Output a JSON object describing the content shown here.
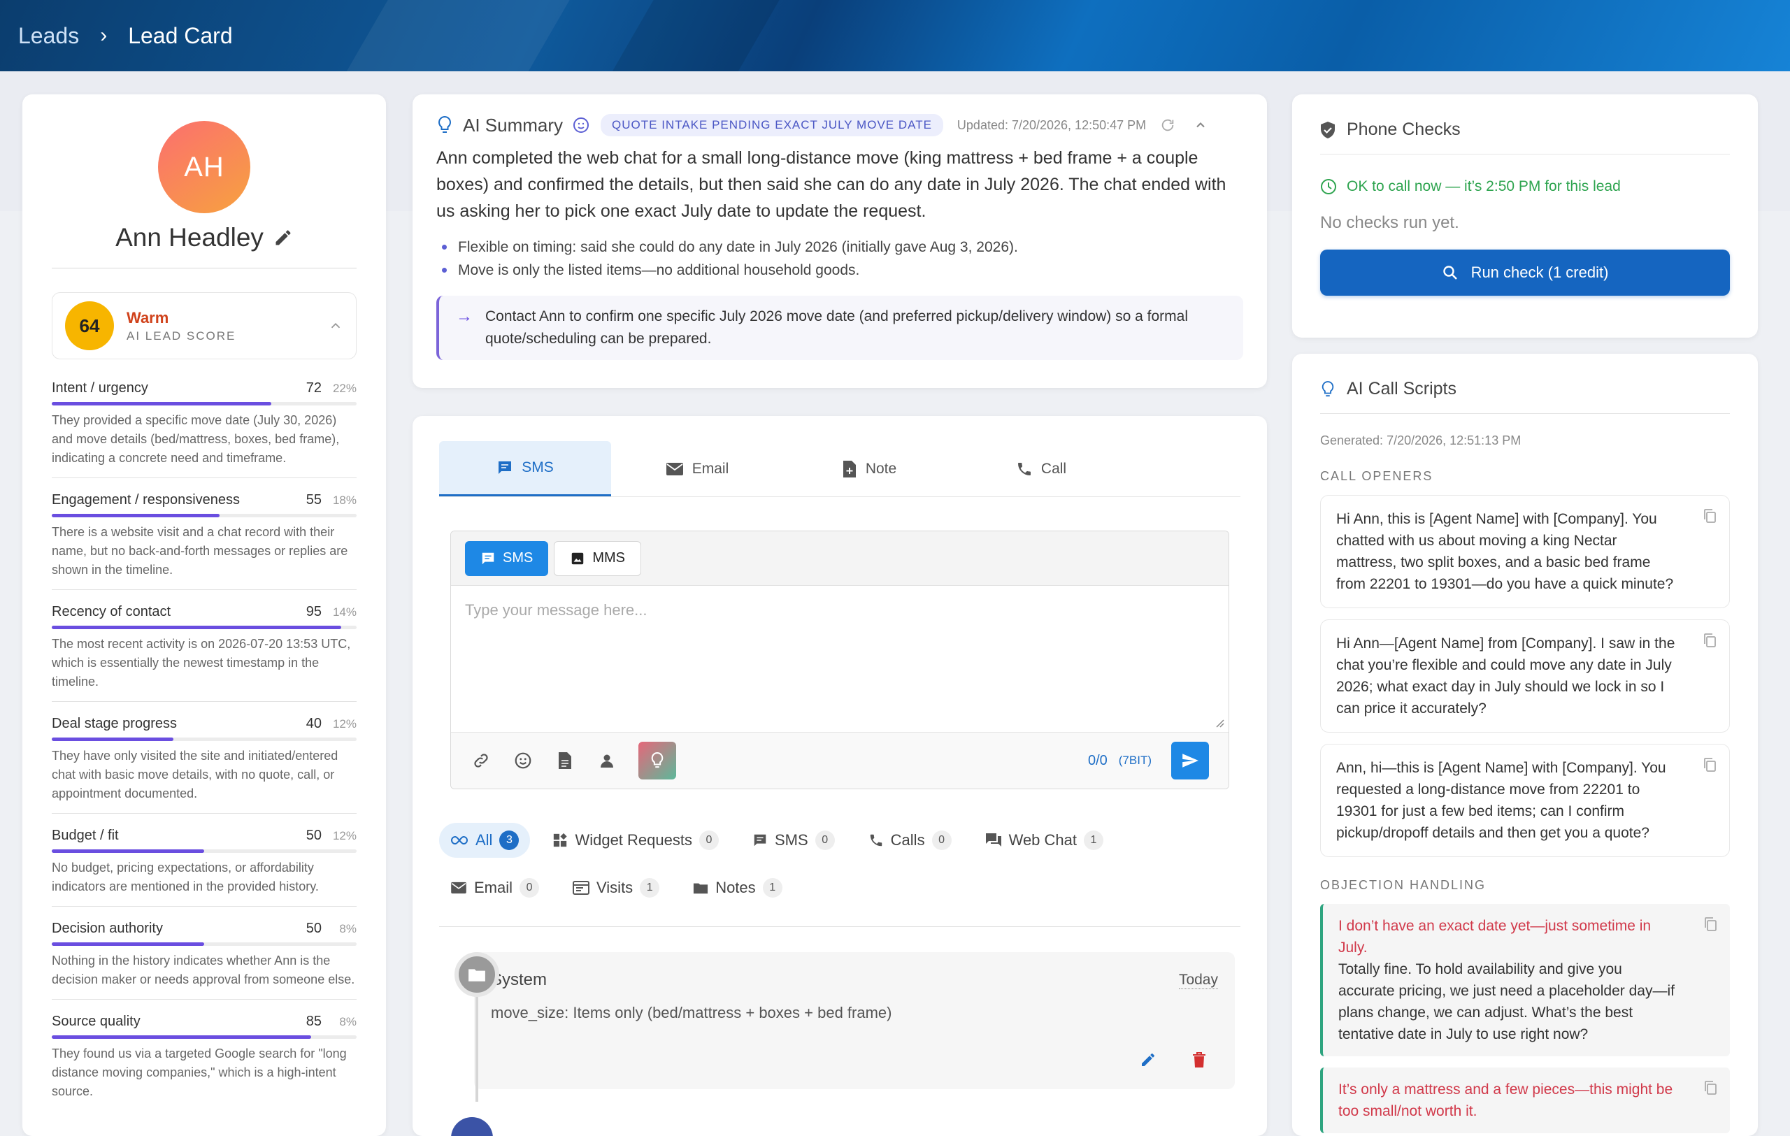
{
  "breadcrumb": {
    "parent": "Leads",
    "current": "Lead Card"
  },
  "lead": {
    "initials": "AH",
    "name": "Ann Headley",
    "score": {
      "value": "64",
      "label": "Warm",
      "sublabel": "AI LEAD SCORE"
    },
    "metrics": [
      {
        "name": "Intent / urgency",
        "value": "72",
        "pct": "22%",
        "level": 0.72,
        "desc": "They provided a specific move date (July 30, 2026) and move details (bed/mattress, boxes, bed frame), indicating a concrete need and timeframe."
      },
      {
        "name": "Engagement / responsiveness",
        "value": "55",
        "pct": "18%",
        "level": 0.55,
        "desc": "There is a website visit and a chat record with their name, but no back-and-forth messages or replies are shown in the timeline."
      },
      {
        "name": "Recency of contact",
        "value": "95",
        "pct": "14%",
        "level": 0.95,
        "desc": "The most recent activity is on 2026-07-20 13:53 UTC, which is essentially the newest timestamp in the timeline."
      },
      {
        "name": "Deal stage progress",
        "value": "40",
        "pct": "12%",
        "level": 0.4,
        "desc": "They have only visited the site and initiated/entered chat with basic move details, with no quote, call, or appointment documented."
      },
      {
        "name": "Budget / fit",
        "value": "50",
        "pct": "12%",
        "level": 0.5,
        "desc": "No budget, pricing expectations, or affordability indicators are mentioned in the provided history."
      },
      {
        "name": "Decision authority",
        "value": "50",
        "pct": "8%",
        "level": 0.5,
        "desc": "Nothing in the history indicates whether Ann is the decision maker or needs approval from someone else."
      },
      {
        "name": "Source quality",
        "value": "85",
        "pct": "8%",
        "level": 0.85,
        "desc": "They found us via a targeted Google search for \"long distance moving companies,\" which is a high-intent source."
      }
    ]
  },
  "summary": {
    "title": "AI Summary",
    "badge": "QUOTE INTAKE PENDING EXACT JULY MOVE DATE",
    "updated": "Updated: 7/20/2026, 12:50:47 PM",
    "body": "Ann completed the web chat for a small long-distance move (king mattress + bed frame + a couple boxes) and confirmed the details, but then said she can do any date in July 2026. The chat ended with us asking her to pick one exact July date to update the request.",
    "bullets": [
      "Flexible on timing: said she could do any date in July 2026 (initially gave Aug 3, 2026).",
      "Move is only the listed items—no additional household goods."
    ],
    "callout": "Contact Ann to confirm one specific July 2026 move date (and preferred pickup/delivery window) so a formal quote/scheduling can be prepared."
  },
  "composer": {
    "tabs": [
      "SMS",
      "Email",
      "Note",
      "Call"
    ],
    "sms_label": "SMS",
    "mms_label": "MMS",
    "placeholder": "Type your message here...",
    "counter": "0/0",
    "encoding": "(7BIT)"
  },
  "filters": [
    {
      "label": "All",
      "count": "3"
    },
    {
      "label": "Widget Requests",
      "count": "0"
    },
    {
      "label": "SMS",
      "count": "0"
    },
    {
      "label": "Calls",
      "count": "0"
    },
    {
      "label": "Web Chat",
      "count": "1"
    },
    {
      "label": "Email",
      "count": "0"
    },
    {
      "label": "Visits",
      "count": "1"
    },
    {
      "label": "Notes",
      "count": "1"
    }
  ],
  "timeline": {
    "title": "System",
    "date": "Today",
    "body": "move_size: Items only (bed/mattress + boxes + bed frame)"
  },
  "phone": {
    "title": "Phone Checks",
    "ok": "OK to call now — it’s 2:50 PM for this lead",
    "nochecks": "No checks run yet.",
    "run": "Run check (1 credit)"
  },
  "scripts": {
    "title": "AI Call Scripts",
    "generated": "Generated: 7/20/2026, 12:51:13 PM",
    "openers_label": "CALL OPENERS",
    "openers": [
      "Hi Ann, this is [Agent Name] with [Company]. You chatted with us about moving a king Nectar mattress, two split boxes, and a basic bed frame from 22201 to 19301—do you have a quick minute?",
      "Hi Ann—[Agent Name] from [Company]. I saw in the chat you’re flexible and could move any date in July 2026; what exact day in July should we lock in so I can price it accurately?",
      "Ann, hi—this is [Agent Name] with [Company]. You requested a long-distance move from 22201 to 19301 for just a few bed items; can I confirm pickup/dropoff details and then get you a quote?"
    ],
    "objections_label": "OBJECTION HANDLING",
    "objections": [
      {
        "q": "I don’t have an exact date yet—just sometime in July.",
        "a": "Totally fine. To hold availability and give you accurate pricing, we just need a placeholder day—if plans change, we can adjust. What’s the best tentative date in July to use right now?"
      },
      {
        "q": "It’s only a mattress and a few pieces—this might be too small/not worth it.",
        "a": ""
      }
    ]
  },
  "colors": {
    "accent": "#1e88e5",
    "score": "#f7b500",
    "warm": "#d0421b",
    "bar": "#6a4ee0",
    "ok": "#2ea44f"
  }
}
